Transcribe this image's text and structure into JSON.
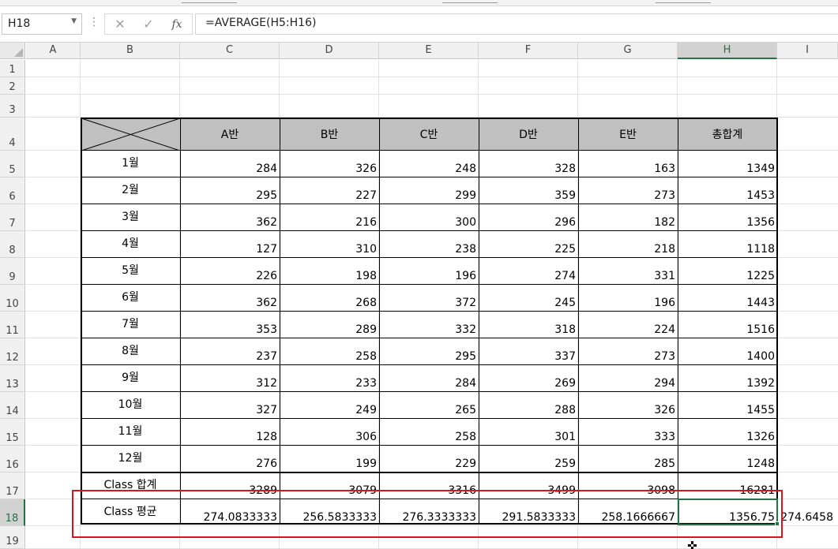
{
  "formula_bar": {
    "name_box": "H18",
    "formula": "=AVERAGE(H5:H16)",
    "cancel_icon": "✕",
    "enter_icon": "✓",
    "fx_label": "fx"
  },
  "columns": [
    "A",
    "B",
    "C",
    "D",
    "E",
    "F",
    "G",
    "H",
    "I"
  ],
  "rows": [
    "1",
    "2",
    "3",
    "4",
    "5",
    "6",
    "7",
    "8",
    "9",
    "10",
    "11",
    "12",
    "13",
    "14",
    "15",
    "16",
    "17",
    "18",
    "19"
  ],
  "selected": {
    "cell": "H18",
    "column": "H",
    "row": "18"
  },
  "table": {
    "headers": [
      "A반",
      "B반",
      "C반",
      "D반",
      "E반",
      "총합계"
    ],
    "months": [
      {
        "label": "1월",
        "values": [
          "284",
          "326",
          "248",
          "328",
          "163",
          "1349"
        ]
      },
      {
        "label": "2월",
        "values": [
          "295",
          "227",
          "299",
          "359",
          "273",
          "1453"
        ]
      },
      {
        "label": "3월",
        "values": [
          "362",
          "216",
          "300",
          "296",
          "182",
          "1356"
        ]
      },
      {
        "label": "4월",
        "values": [
          "127",
          "310",
          "238",
          "225",
          "218",
          "1118"
        ]
      },
      {
        "label": "5월",
        "values": [
          "226",
          "198",
          "196",
          "274",
          "331",
          "1225"
        ]
      },
      {
        "label": "6월",
        "values": [
          "362",
          "268",
          "372",
          "245",
          "196",
          "1443"
        ]
      },
      {
        "label": "7월",
        "values": [
          "353",
          "289",
          "332",
          "318",
          "224",
          "1516"
        ]
      },
      {
        "label": "8월",
        "values": [
          "237",
          "258",
          "295",
          "337",
          "273",
          "1400"
        ]
      },
      {
        "label": "9월",
        "values": [
          "312",
          "233",
          "284",
          "269",
          "294",
          "1392"
        ]
      },
      {
        "label": "10월",
        "values": [
          "327",
          "249",
          "265",
          "288",
          "326",
          "1455"
        ]
      },
      {
        "label": "11월",
        "values": [
          "128",
          "306",
          "258",
          "301",
          "333",
          "1326"
        ]
      },
      {
        "label": "12월",
        "values": [
          "276",
          "199",
          "229",
          "259",
          "285",
          "1248"
        ]
      }
    ],
    "total_row": {
      "label": "Class 합계",
      "values": [
        "3289",
        "3079",
        "3316",
        "3499",
        "3098",
        "16281"
      ]
    },
    "average_row": {
      "label": "Class 평균",
      "values": [
        "274.0833333",
        "256.5833333",
        "276.3333333",
        "291.5833333",
        "258.1666667",
        "1356.75"
      ]
    },
    "outside_value": "274.6458"
  },
  "colors": {
    "excel_green": "#217346",
    "highlight_red": "#d9151b",
    "header_fill": "#c0c0c0"
  }
}
